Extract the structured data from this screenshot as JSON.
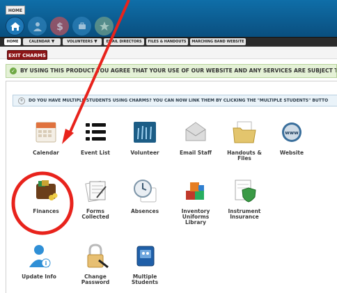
{
  "header": {
    "home_label": "HOME"
  },
  "nav": {
    "tabs": [
      {
        "label": "HOME"
      },
      {
        "label": "CALENDAR"
      },
      {
        "label": "VOLUNTEERS"
      },
      {
        "label": "EMAIL DIRECTORS"
      },
      {
        "label": "FILES & HANDOUTS"
      },
      {
        "label": "MARCHING BAND WEBSITE"
      }
    ]
  },
  "exit_button": "EXIT CHARMS",
  "notice": "BY USING THIS PRODUCT YOU AGREE THAT YOUR USE OF OUR WEBSITE AND ANY SERVICES ARE SUBJECT TO OUR",
  "multi_students_notice": "DO YOU HAVE MULTIPLE STUDENTS USING CHARMS? YOU CAN NOW LINK THEM BY CLICKING THE \"MULTIPLE STUDENTS\" BUTTO",
  "tiles": [
    {
      "label": "Calendar",
      "icon": "calendar-icon"
    },
    {
      "label": "Event List",
      "icon": "list-icon"
    },
    {
      "label": "Volunteer",
      "icon": "volunteer-icon"
    },
    {
      "label": "Email Staff",
      "icon": "email-icon"
    },
    {
      "label": "Handouts & Files",
      "icon": "folder-icon"
    },
    {
      "label": "Website",
      "icon": "globe-icon"
    },
    {
      "label": "Finances",
      "icon": "wallet-icon"
    },
    {
      "label": "Forms Collected",
      "icon": "forms-icon"
    },
    {
      "label": "Absences",
      "icon": "clock-icon"
    },
    {
      "label": "Inventory\nUniforms\nLibrary",
      "icon": "blocks-icon"
    },
    {
      "label": "Instrument\nInsurance",
      "icon": "insurance-icon"
    },
    {
      "label": "Update Info",
      "icon": "user-info-icon"
    },
    {
      "label": "Change\nPassword",
      "icon": "padlock-icon"
    },
    {
      "label": "Multiple\nStudents",
      "icon": "multiple-students-icon"
    }
  ],
  "colors": {
    "header": "#0a4f7f",
    "exit": "#8b1416",
    "annotation": "#e8231c"
  }
}
